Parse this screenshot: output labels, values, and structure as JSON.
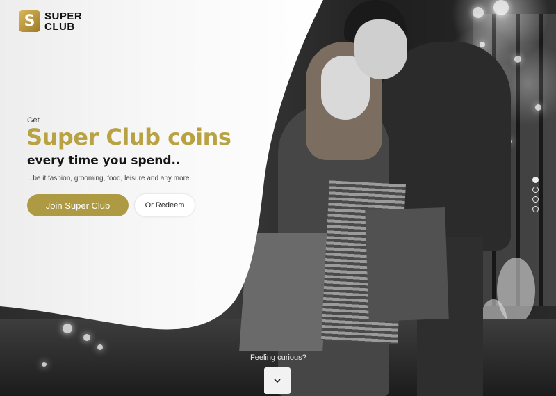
{
  "brand": {
    "line1": "SUPER",
    "line2": "CLUB",
    "mark_glyph": "S",
    "accent": "#ae9a42"
  },
  "hero": {
    "eyebrow": "Get",
    "title": "Super Club coins",
    "subtitle": "every time you spend..",
    "description": "...be it fashion, grooming, food, leisure and  any more."
  },
  "actions": {
    "join_label": "Join Super Club",
    "redeem_label": "Or Redeem"
  },
  "carousel": {
    "slide_count": 4,
    "active_index": 0
  },
  "footer": {
    "prompt": "Feeling curious?",
    "scroll_icon": "chevron-down-icon"
  }
}
